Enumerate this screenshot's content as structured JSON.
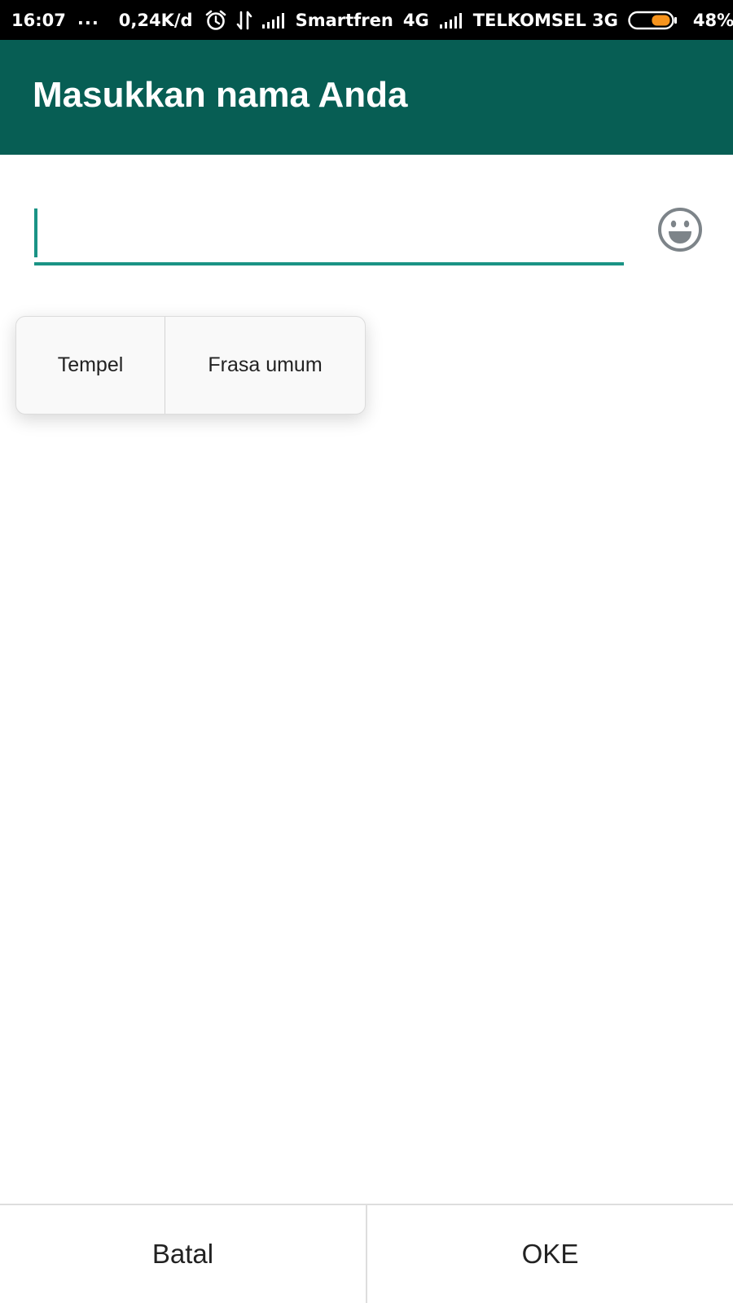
{
  "status_bar": {
    "time": "16:07",
    "dots": "...",
    "data_speed": "0,24K/d",
    "carrier_1": "Smartfren",
    "network_1": "4G",
    "carrier_2": "TELKOMSEL 3G",
    "battery_percent": "48%",
    "battery_level": 0.48,
    "battery_color": "#f7941d"
  },
  "app_bar": {
    "title": "Masukkan nama Anda",
    "color": "#075e54"
  },
  "name_field": {
    "value": "",
    "placeholder": "",
    "accent_color": "#1a9385",
    "emoji_icon": "emoji-icon"
  },
  "text_popup": {
    "paste_label": "Tempel",
    "phrases_label": "Frasa umum"
  },
  "actions": {
    "cancel_label": "Batal",
    "ok_label": "OKE"
  }
}
